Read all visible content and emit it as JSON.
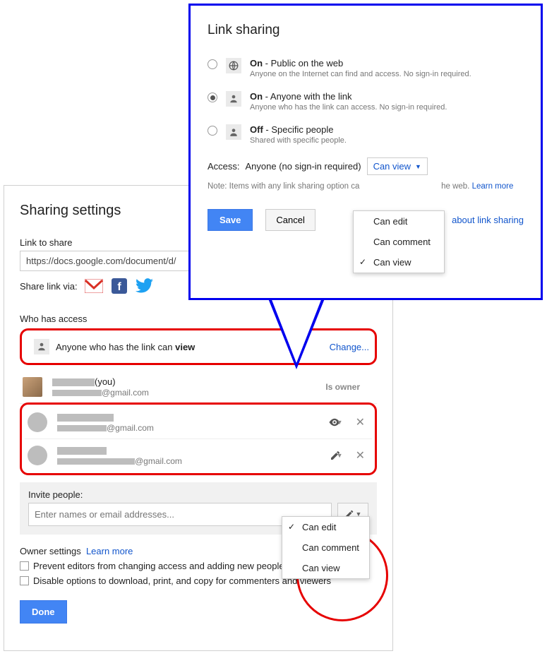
{
  "sharing": {
    "title": "Sharing settings",
    "link_label": "Link to share",
    "link_value": "https://docs.google.com/document/d/",
    "share_via_label": "Share link via:",
    "who_label": "Who has access",
    "access_row": {
      "text_prefix": "Anyone who has the link can ",
      "text_bold": "view",
      "change": "Change..."
    },
    "users": [
      {
        "you_suffix": "(you)",
        "email_suffix": "@gmail.com",
        "role": "Is owner"
      },
      {
        "email_suffix": "@gmail.com",
        "perm_icon": "eye"
      },
      {
        "email_suffix": "@gmail.com",
        "perm_icon": "pencil"
      }
    ],
    "invite": {
      "label": "Invite people:",
      "placeholder": "Enter names or email addresses...",
      "menu": [
        "Can edit",
        "Can comment",
        "Can view"
      ],
      "selected_index": 0
    },
    "owner_settings": {
      "label": "Owner settings",
      "learn": "Learn more",
      "opt1": "Prevent editors from changing access and adding new people",
      "opt2": "Disable options to download, print, and copy for commenters and viewers"
    },
    "done": "Done"
  },
  "link_sharing": {
    "title": "Link sharing",
    "options": [
      {
        "title_bold": "On",
        "title_rest": " - Public on the web",
        "sub": "Anyone on the Internet can find and access. No sign-in required.",
        "icon": "globe",
        "selected": false
      },
      {
        "title_bold": "On",
        "title_rest": " - Anyone with the link",
        "sub": "Anyone who has the link can access. No sign-in required.",
        "icon": "link-person",
        "selected": true
      },
      {
        "title_bold": "Off",
        "title_rest": " - Specific people",
        "sub": "Shared with specific people.",
        "icon": "person",
        "selected": false
      }
    ],
    "access_label": "Access:",
    "access_who": "Anyone (no sign-in required)",
    "access_perm": "Can view",
    "note_prefix": "Note: Items with any link sharing option ca",
    "note_suffix": "he web.",
    "note_link": "Learn more",
    "save": "Save",
    "cancel": "Cancel",
    "learn_about": "about link sharing",
    "perm_menu": [
      "Can edit",
      "Can comment",
      "Can view"
    ],
    "perm_selected_index": 2
  }
}
